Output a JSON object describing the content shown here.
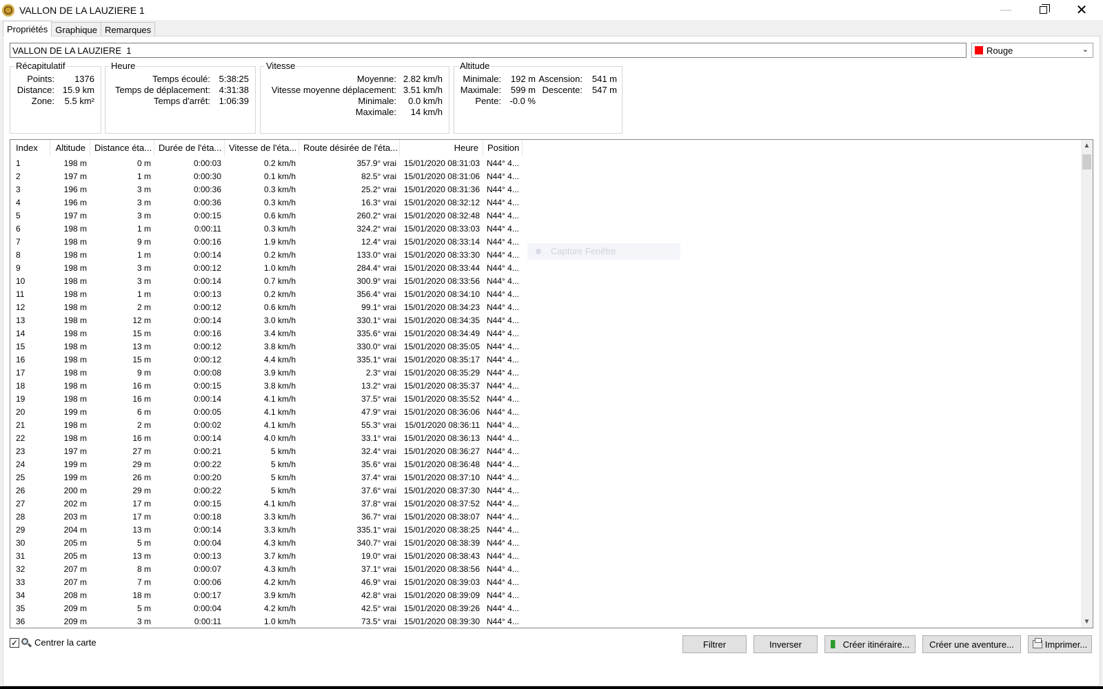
{
  "window": {
    "title": "VALLON DE LA LAUZIERE  1"
  },
  "tabs": [
    {
      "label": "Propriétés",
      "active": true
    },
    {
      "label": "Graphique",
      "active": false
    },
    {
      "label": "Remarques",
      "active": false
    }
  ],
  "track": {
    "name_value": "VALLON DE LA LAUZIERE  1",
    "color_value": "Rouge",
    "color_hex": "#ff0000"
  },
  "summary": {
    "title": "Récapitulatif",
    "points_label": "Points:",
    "points_value": "1376",
    "distance_label": "Distance:",
    "distance_value": "15.9 km",
    "zone_label": "Zone:",
    "zone_value": "5.5 km²"
  },
  "time": {
    "title": "Heure",
    "elapsed_label": "Temps écoulé:",
    "elapsed_value": "5:38:25",
    "moving_label": "Temps de déplacement:",
    "moving_value": "4:31:38",
    "stopped_label": "Temps d'arrêt:",
    "stopped_value": "1:06:39"
  },
  "speed": {
    "title": "Vitesse",
    "avg_label": "Moyenne:",
    "avg_value": "2.82 km/h",
    "moving_avg_label": "Vitesse moyenne déplacement:",
    "moving_avg_value": "3.51 km/h",
    "min_label": "Minimale:",
    "min_value": "0.0 km/h",
    "max_label": "Maximale:",
    "max_value": "14 km/h"
  },
  "altitude": {
    "title": "Altitude",
    "min_label": "Minimale:",
    "min_value": "192 m",
    "max_label": "Maximale:",
    "max_value": "599 m",
    "slope_label": "Pente:",
    "slope_value": "-0.0 %",
    "ascent_label": "Ascension:",
    "ascent_value": "541 m",
    "descent_label": "Descente:",
    "descent_value": "547 m"
  },
  "table": {
    "columns": [
      "Index",
      "Altitude",
      "Distance éta...",
      "Durée de l'éta...",
      "Vitesse de l'éta...",
      "Route désirée de l'éta...",
      "Heure",
      "Position"
    ],
    "rows": [
      [
        "1",
        "198 m",
        "0 m",
        "0:00:03",
        "0.2 km/h",
        "357.9° vrai",
        "15/01/2020 08:31:03",
        "N44° 4..."
      ],
      [
        "2",
        "197 m",
        "1 m",
        "0:00:30",
        "0.1 km/h",
        "82.5° vrai",
        "15/01/2020 08:31:06",
        "N44° 4..."
      ],
      [
        "3",
        "196 m",
        "3 m",
        "0:00:36",
        "0.3 km/h",
        "25.2° vrai",
        "15/01/2020 08:31:36",
        "N44° 4..."
      ],
      [
        "4",
        "196 m",
        "3 m",
        "0:00:36",
        "0.3 km/h",
        "16.3° vrai",
        "15/01/2020 08:32:12",
        "N44° 4..."
      ],
      [
        "5",
        "197 m",
        "3 m",
        "0:00:15",
        "0.6 km/h",
        "260.2° vrai",
        "15/01/2020 08:32:48",
        "N44° 4..."
      ],
      [
        "6",
        "198 m",
        "1 m",
        "0:00:11",
        "0.3 km/h",
        "324.2° vrai",
        "15/01/2020 08:33:03",
        "N44° 4..."
      ],
      [
        "7",
        "198 m",
        "9 m",
        "0:00:16",
        "1.9 km/h",
        "12.4° vrai",
        "15/01/2020 08:33:14",
        "N44° 4..."
      ],
      [
        "8",
        "198 m",
        "1 m",
        "0:00:14",
        "0.2 km/h",
        "133.0° vrai",
        "15/01/2020 08:33:30",
        "N44° 4..."
      ],
      [
        "9",
        "198 m",
        "3 m",
        "0:00:12",
        "1.0 km/h",
        "284.4° vrai",
        "15/01/2020 08:33:44",
        "N44° 4..."
      ],
      [
        "10",
        "198 m",
        "3 m",
        "0:00:14",
        "0.7 km/h",
        "300.9° vrai",
        "15/01/2020 08:33:56",
        "N44° 4..."
      ],
      [
        "11",
        "198 m",
        "1 m",
        "0:00:13",
        "0.2 km/h",
        "356.4° vrai",
        "15/01/2020 08:34:10",
        "N44° 4..."
      ],
      [
        "12",
        "198 m",
        "2 m",
        "0:00:12",
        "0.6 km/h",
        "99.1° vrai",
        "15/01/2020 08:34:23",
        "N44° 4..."
      ],
      [
        "13",
        "198 m",
        "12 m",
        "0:00:14",
        "3.0 km/h",
        "330.1° vrai",
        "15/01/2020 08:34:35",
        "N44° 4..."
      ],
      [
        "14",
        "198 m",
        "15 m",
        "0:00:16",
        "3.4 km/h",
        "335.6° vrai",
        "15/01/2020 08:34:49",
        "N44° 4..."
      ],
      [
        "15",
        "198 m",
        "13 m",
        "0:00:12",
        "3.8 km/h",
        "330.0° vrai",
        "15/01/2020 08:35:05",
        "N44° 4..."
      ],
      [
        "16",
        "198 m",
        "15 m",
        "0:00:12",
        "4.4 km/h",
        "335.1° vrai",
        "15/01/2020 08:35:17",
        "N44° 4..."
      ],
      [
        "17",
        "198 m",
        "9 m",
        "0:00:08",
        "3.9 km/h",
        "2.3° vrai",
        "15/01/2020 08:35:29",
        "N44° 4..."
      ],
      [
        "18",
        "198 m",
        "16 m",
        "0:00:15",
        "3.8 km/h",
        "13.2° vrai",
        "15/01/2020 08:35:37",
        "N44° 4..."
      ],
      [
        "19",
        "198 m",
        "16 m",
        "0:00:14",
        "4.1 km/h",
        "37.5° vrai",
        "15/01/2020 08:35:52",
        "N44° 4..."
      ],
      [
        "20",
        "199 m",
        "6 m",
        "0:00:05",
        "4.1 km/h",
        "47.9° vrai",
        "15/01/2020 08:36:06",
        "N44° 4..."
      ],
      [
        "21",
        "198 m",
        "2 m",
        "0:00:02",
        "4.1 km/h",
        "55.3° vrai",
        "15/01/2020 08:36:11",
        "N44° 4..."
      ],
      [
        "22",
        "198 m",
        "16 m",
        "0:00:14",
        "4.0 km/h",
        "33.1° vrai",
        "15/01/2020 08:36:13",
        "N44° 4..."
      ],
      [
        "23",
        "197 m",
        "27 m",
        "0:00:21",
        "5 km/h",
        "32.4° vrai",
        "15/01/2020 08:36:27",
        "N44° 4..."
      ],
      [
        "24",
        "199 m",
        "29 m",
        "0:00:22",
        "5 km/h",
        "35.6° vrai",
        "15/01/2020 08:36:48",
        "N44° 4..."
      ],
      [
        "25",
        "199 m",
        "26 m",
        "0:00:20",
        "5 km/h",
        "37.4° vrai",
        "15/01/2020 08:37:10",
        "N44° 4..."
      ],
      [
        "26",
        "200 m",
        "29 m",
        "0:00:22",
        "5 km/h",
        "37.6° vrai",
        "15/01/2020 08:37:30",
        "N44° 4..."
      ],
      [
        "27",
        "202 m",
        "17 m",
        "0:00:15",
        "4.1 km/h",
        "37.8° vrai",
        "15/01/2020 08:37:52",
        "N44° 4..."
      ],
      [
        "28",
        "203 m",
        "17 m",
        "0:00:18",
        "3.3 km/h",
        "36.7° vrai",
        "15/01/2020 08:38:07",
        "N44° 4..."
      ],
      [
        "29",
        "204 m",
        "13 m",
        "0:00:14",
        "3.3 km/h",
        "335.1° vrai",
        "15/01/2020 08:38:25",
        "N44° 4..."
      ],
      [
        "30",
        "205 m",
        "5 m",
        "0:00:04",
        "4.3 km/h",
        "340.7° vrai",
        "15/01/2020 08:38:39",
        "N44° 4..."
      ],
      [
        "31",
        "205 m",
        "13 m",
        "0:00:13",
        "3.7 km/h",
        "19.0° vrai",
        "15/01/2020 08:38:43",
        "N44° 4..."
      ],
      [
        "32",
        "207 m",
        "8 m",
        "0:00:07",
        "4.3 km/h",
        "37.1° vrai",
        "15/01/2020 08:38:56",
        "N44° 4..."
      ],
      [
        "33",
        "207 m",
        "7 m",
        "0:00:06",
        "4.2 km/h",
        "46.9° vrai",
        "15/01/2020 08:39:03",
        "N44° 4..."
      ],
      [
        "34",
        "208 m",
        "18 m",
        "0:00:17",
        "3.9 km/h",
        "42.8° vrai",
        "15/01/2020 08:39:09",
        "N44° 4..."
      ],
      [
        "35",
        "209 m",
        "5 m",
        "0:00:04",
        "4.2 km/h",
        "42.5° vrai",
        "15/01/2020 08:39:26",
        "N44° 4..."
      ],
      [
        "36",
        "209 m",
        "3 m",
        "0:00:11",
        "1.0 km/h",
        "73.5° vrai",
        "15/01/2020 08:39:30",
        "N44° 4..."
      ]
    ]
  },
  "ghost_tooltip": "Capture Fenêtre",
  "bottom": {
    "center_map_label": "Centrer la carte",
    "center_map_checked": true,
    "filter_label": "Filtrer",
    "invert_label": "Inverser",
    "create_route_label": "Créer itinéraire...",
    "create_adventure_label": "Créer une aventure...",
    "print_label": "Imprimer..."
  }
}
